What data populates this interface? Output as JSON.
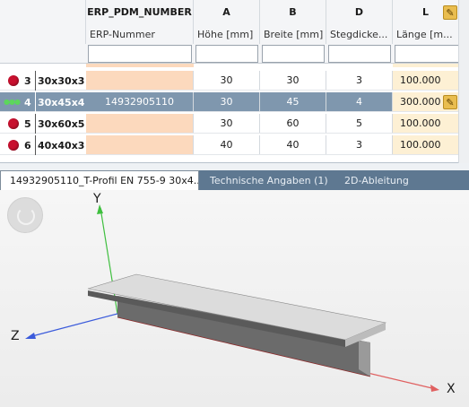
{
  "grid": {
    "headers": [
      "ERP_PDM_NUMBER",
      "A",
      "B",
      "D",
      "L"
    ],
    "subheaders": [
      "ERP-Nummer",
      "Höhe [mm]",
      "Breite [mm]",
      "Stegdicke...",
      "Länge [m..."
    ],
    "rows": [
      {
        "num": "3",
        "name": "30x30x3",
        "erp": "",
        "a": "30",
        "b": "30",
        "d": "3",
        "l": "100.000"
      },
      {
        "num": "4",
        "name": "30x45x4",
        "erp": "14932905110",
        "a": "30",
        "b": "45",
        "d": "4",
        "l": "300.000"
      },
      {
        "num": "5",
        "name": "30x60x5",
        "erp": "",
        "a": "30",
        "b": "60",
        "d": "5",
        "l": "100.000"
      },
      {
        "num": "6",
        "name": "40x40x3",
        "erp": "",
        "a": "40",
        "b": "40",
        "d": "3",
        "l": "100.000"
      }
    ],
    "selected_row": "4",
    "marker_color": "#c8102e",
    "selected_color": "#7f97ae"
  },
  "tabs": [
    {
      "label": "14932905110_T-Profil EN 755-9 30x4..."
    },
    {
      "label": "Technische Angaben (1)"
    },
    {
      "label": "2D-Ableitung"
    }
  ],
  "viewer": {
    "axes": {
      "x": "X",
      "y": "Y",
      "z": "Z"
    },
    "axis_colors": {
      "x": "#e06060",
      "y": "#3fbf3f",
      "z": "#3b5bdb"
    }
  }
}
